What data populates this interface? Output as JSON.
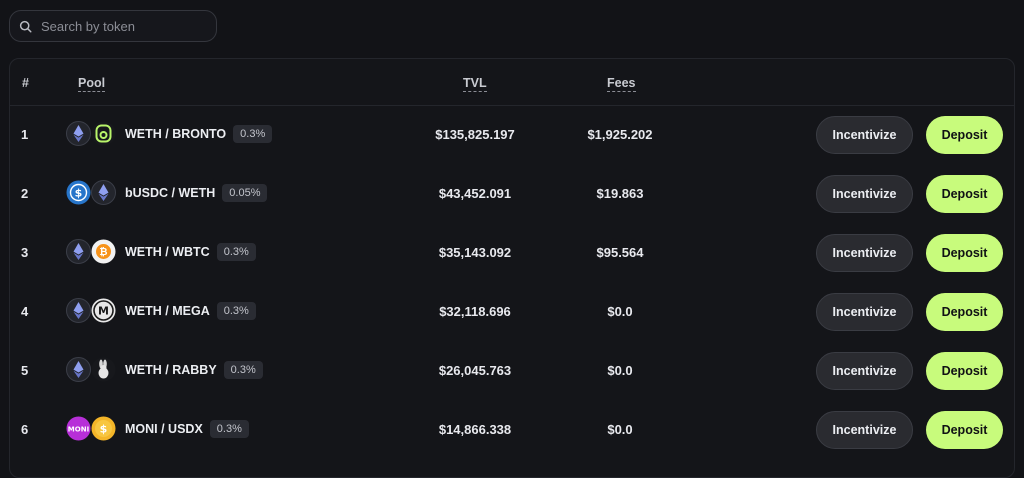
{
  "search": {
    "placeholder": "Search by token"
  },
  "table": {
    "headers": {
      "rank": "#",
      "pool": "Pool",
      "tvl": "TVL",
      "fees": "Fees"
    },
    "rows": [
      {
        "rank": "1",
        "pair": "WETH / BRONTO",
        "fee_tier": "0.3%",
        "tvl": "$135,825.197",
        "fees": "$1,925.202",
        "incentivize": "Incentivize",
        "deposit": "Deposit"
      },
      {
        "rank": "2",
        "pair": "bUSDC / WETH",
        "fee_tier": "0.05%",
        "tvl": "$43,452.091",
        "fees": "$19.863",
        "incentivize": "Incentivize",
        "deposit": "Deposit"
      },
      {
        "rank": "3",
        "pair": "WETH / WBTC",
        "fee_tier": "0.3%",
        "tvl": "$35,143.092",
        "fees": "$95.564",
        "incentivize": "Incentivize",
        "deposit": "Deposit"
      },
      {
        "rank": "4",
        "pair": "WETH / MEGA",
        "fee_tier": "0.3%",
        "tvl": "$32,118.696",
        "fees": "$0.0",
        "incentivize": "Incentivize",
        "deposit": "Deposit"
      },
      {
        "rank": "5",
        "pair": "WETH / RABBY",
        "fee_tier": "0.3%",
        "tvl": "$26,045.763",
        "fees": "$0.0",
        "incentivize": "Incentivize",
        "deposit": "Deposit"
      },
      {
        "rank": "6",
        "pair": "MONI / USDX",
        "fee_tier": "0.3%",
        "tvl": "$14,866.338",
        "fees": "$0.0",
        "incentivize": "Incentivize",
        "deposit": "Deposit"
      }
    ]
  },
  "icons": {
    "row1": [
      "eth-icon",
      "bronto-icon"
    ],
    "row2": [
      "usdc-icon",
      "eth-icon"
    ],
    "row3": [
      "eth-icon",
      "btc-icon"
    ],
    "row4": [
      "eth-icon",
      "mega-icon"
    ],
    "row5": [
      "eth-icon",
      "rabby-icon"
    ],
    "row6": [
      "moni-icon",
      "usdx-icon"
    ]
  },
  "colors": {
    "accent": "#c8fb7c",
    "background": "#121317",
    "button_dark": "#2a2b30"
  }
}
